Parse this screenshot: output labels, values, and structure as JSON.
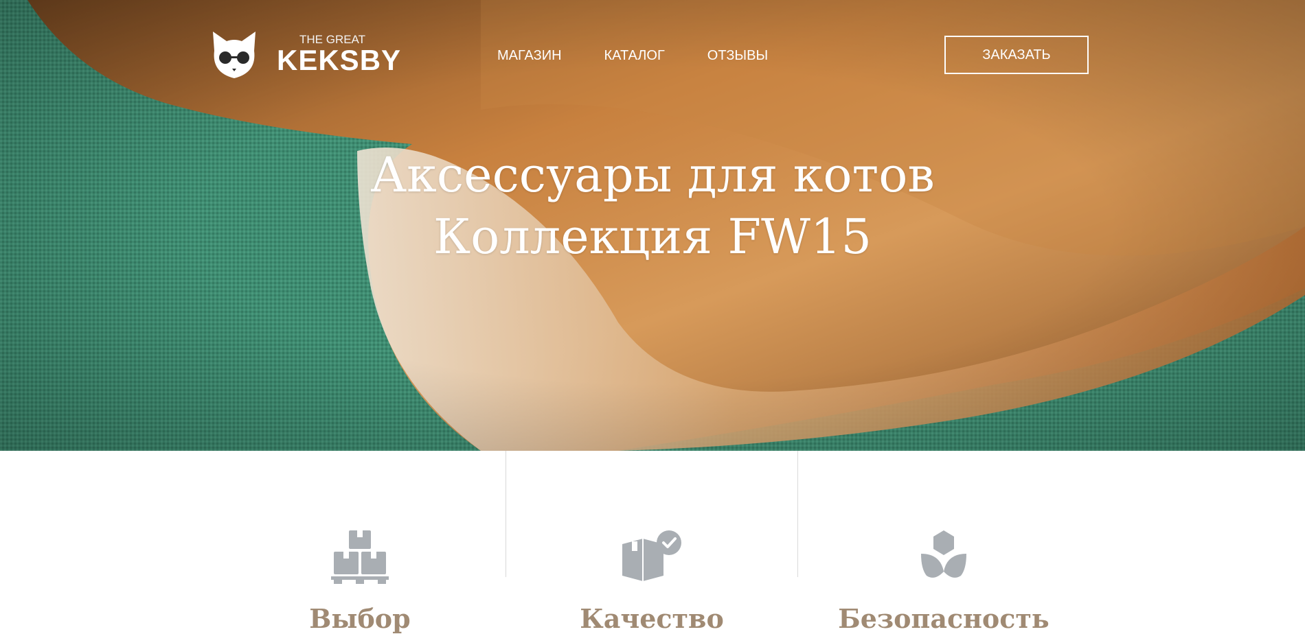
{
  "logo": {
    "top": "THE GREAT",
    "name": "KEKSBY"
  },
  "nav": {
    "items": [
      "МАГАЗИН",
      "КАТАЛОГ",
      "ОТЗЫВЫ"
    ]
  },
  "order_button": "ЗАКАЗАТЬ",
  "hero": {
    "line1": "Аксессуары для котов",
    "line2": "Коллекция FW15"
  },
  "features": [
    {
      "title": "Выбор",
      "icon": "boxes-pallet-icon"
    },
    {
      "title": "Качество",
      "icon": "box-check-icon"
    },
    {
      "title": "Безопасность",
      "icon": "lotus-icon"
    }
  ],
  "colors": {
    "accent": "#a08a73",
    "icon_gray": "#a9aeb3",
    "fabric": "#3f8d72",
    "fur": "#c97d3c"
  }
}
